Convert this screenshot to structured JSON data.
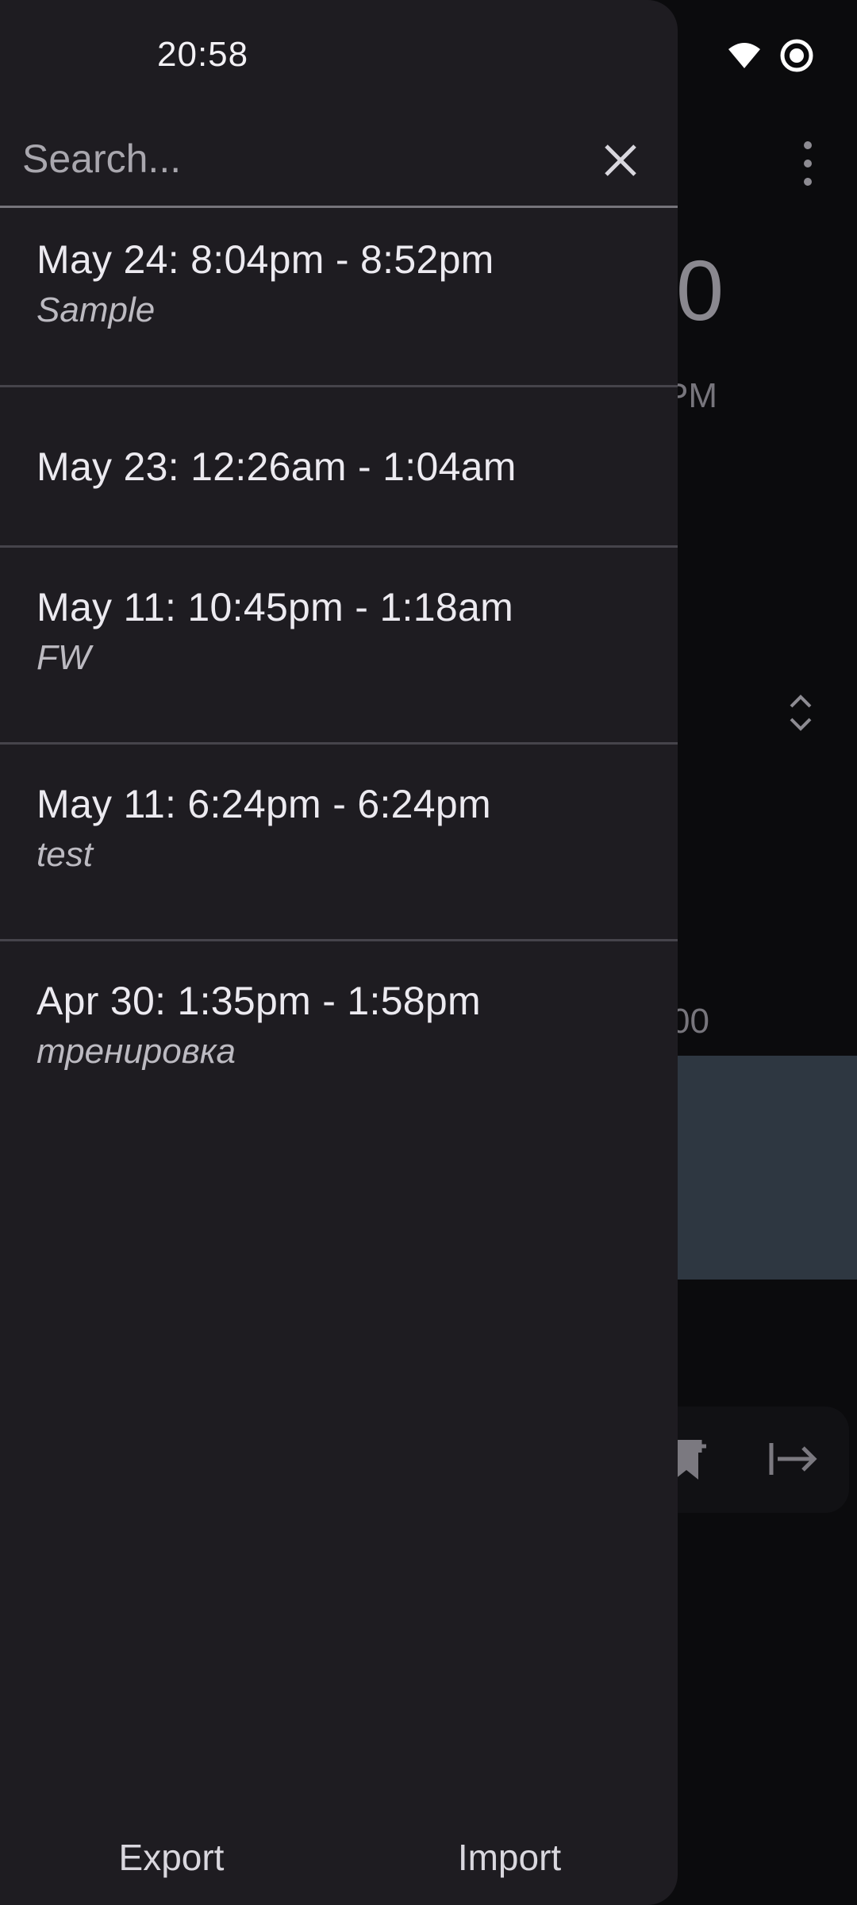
{
  "status_bar": {
    "time": "20:58"
  },
  "search": {
    "placeholder": "Search..."
  },
  "sessions": [
    {
      "time": "May 24: 8:04pm - 8:52pm",
      "note": "Sample"
    },
    {
      "time": "May 23: 12:26am - 1:04am",
      "note": ""
    },
    {
      "time": "May 11: 10:45pm - 1:18am",
      "note": "FW"
    },
    {
      "time": "May 11: 6:24pm - 6:24pm",
      "note": "test"
    },
    {
      "time": "Apr 30: 1:35pm - 1:58pm",
      "note": "тренировка"
    }
  ],
  "footer": {
    "export_label": "Export",
    "import_label": "Import"
  },
  "background": {
    "big_digit": "0",
    "ampm": "PM",
    "time_label": "00"
  },
  "colors": {
    "drawer_bg": "#1e1c21",
    "app_bg": "#0b0b0d",
    "panel": "#2e3741",
    "divider": "#46444b"
  }
}
